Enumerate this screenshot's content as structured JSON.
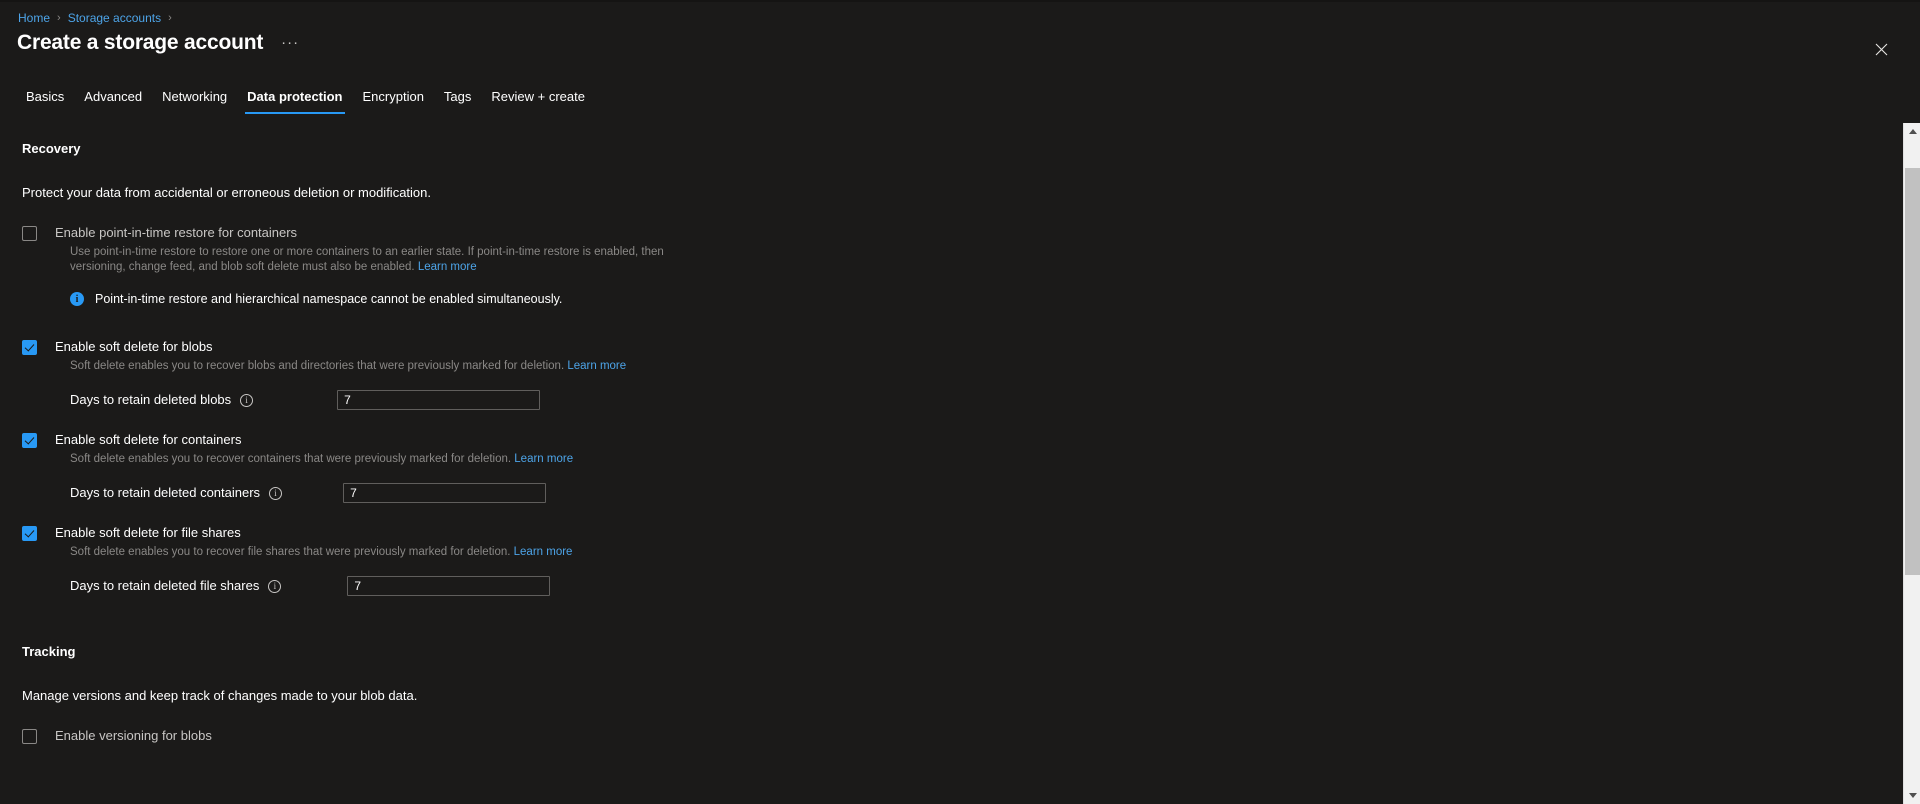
{
  "breadcrumb": {
    "items": [
      {
        "label": "Home",
        "link": true
      },
      {
        "label": "Storage accounts",
        "link": true
      }
    ],
    "separator": "›"
  },
  "header": {
    "title": "Create a storage account",
    "more_label": "···",
    "close_label": "Close",
    "accent_color": "#2899f5"
  },
  "tabs": [
    {
      "label": "Basics",
      "active": false
    },
    {
      "label": "Advanced",
      "active": false
    },
    {
      "label": "Networking",
      "active": false
    },
    {
      "label": "Data protection",
      "active": true
    },
    {
      "label": "Encryption",
      "active": false
    },
    {
      "label": "Tags",
      "active": false
    },
    {
      "label": "Review + create",
      "active": false
    }
  ],
  "recovery": {
    "heading": "Recovery",
    "description": "Protect your data from accidental or erroneous deletion or modification.",
    "point_in_time": {
      "label": "Enable point-in-time restore for containers",
      "checked": false,
      "description": "Use point-in-time restore to restore one or more containers to an earlier state. If point-in-time restore is enabled, then versioning, change feed, and blob soft delete must also be enabled.",
      "learn_more": "Learn more"
    },
    "info": {
      "icon": "info-icon",
      "text": "Point-in-time restore and hierarchical namespace cannot be enabled simultaneously."
    },
    "soft_delete_blobs": {
      "label": "Enable soft delete for blobs",
      "checked": true,
      "description": "Soft delete enables you to recover blobs and directories that were previously marked for deletion.",
      "learn_more": "Learn more",
      "field_label": "Days to retain deleted blobs",
      "field_value": "7"
    },
    "soft_delete_containers": {
      "label": "Enable soft delete for containers",
      "checked": true,
      "description": "Soft delete enables you to recover containers that were previously marked for deletion.",
      "learn_more": "Learn more",
      "field_label": "Days to retain deleted containers",
      "field_value": "7"
    },
    "soft_delete_file_shares": {
      "label": "Enable soft delete for file shares",
      "checked": true,
      "description": "Soft delete enables you to recover file shares that were previously marked for deletion.",
      "learn_more": "Learn more",
      "field_label": "Days to retain deleted file shares",
      "field_value": "7"
    }
  },
  "tracking": {
    "heading": "Tracking",
    "description": "Manage versions and keep track of changes made to your blob data.",
    "versioning": {
      "label": "Enable versioning for blobs",
      "checked": false
    }
  }
}
